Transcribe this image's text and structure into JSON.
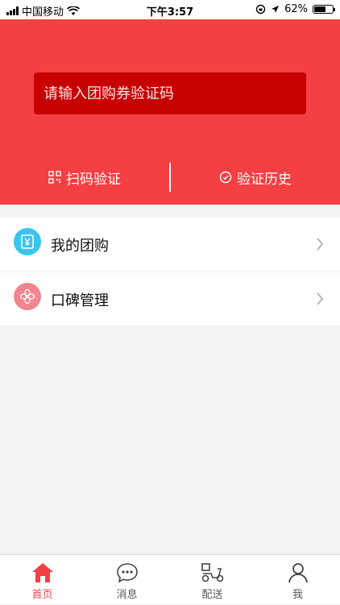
{
  "status_bar": {
    "carrier": "中国移动",
    "time": "下午3:57",
    "battery_percent": "62%",
    "battery_level": 0.62
  },
  "hero": {
    "input_placeholder": "请输入团购券验证码",
    "scan_label": "扫码验证",
    "history_label": "验证历史",
    "background_color": "#f43f43",
    "input_color": "#c60000"
  },
  "menu": {
    "items": [
      {
        "label": "我的团购",
        "icon": "yen-voucher-icon",
        "icon_color": "#39c6ec"
      },
      {
        "label": "口碑管理",
        "icon": "flower-icon",
        "icon_color": "#f0868f"
      }
    ]
  },
  "tabbar": {
    "tabs": [
      {
        "label": "首页",
        "icon": "home-icon",
        "active": true
      },
      {
        "label": "消息",
        "icon": "message-icon",
        "active": false
      },
      {
        "label": "配送",
        "icon": "delivery-scooter-icon",
        "active": false
      },
      {
        "label": "我",
        "icon": "user-icon",
        "active": false
      }
    ],
    "active_color": "#f43f43"
  }
}
